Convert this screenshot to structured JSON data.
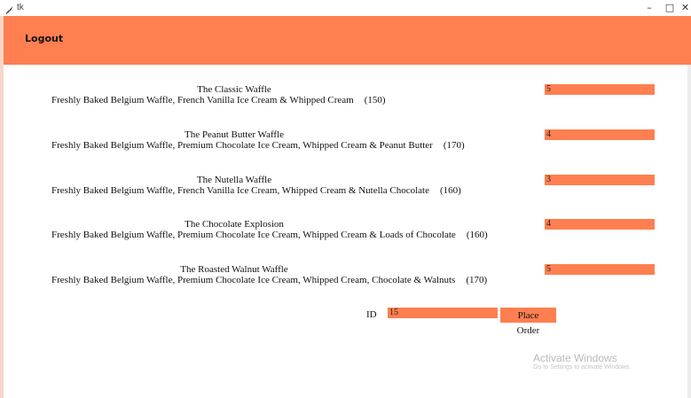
{
  "window": {
    "title": "tk",
    "controls": {
      "minimize": "–",
      "maximize": "□",
      "close": "✕"
    }
  },
  "header": {
    "logout_label": "Logout"
  },
  "menu": {
    "items": [
      {
        "name": "The Classic Waffle",
        "description": "Freshly Baked Belgium Waffle, French Vanilla Ice Cream & Whipped Cream",
        "price": "(150)",
        "quantity": "5"
      },
      {
        "name": "The Peanut Butter Waffle",
        "description": "Freshly Baked Belgium Waffle, Premium Chocolate Ice Cream, Whipped Cream & Peanut Butter",
        "price": "(170)",
        "quantity": "4"
      },
      {
        "name": "The Nutella Waffle",
        "description": "Freshly Baked Belgium Waffle, French Vanilla Ice Cream, Whipped Cream & Nutella Chocolate",
        "price": "(160)",
        "quantity": "3"
      },
      {
        "name": "The Chocolate Explosion",
        "description": "Freshly Baked Belgium Waffle, Premium Chocolate Ice Cream, Whipped Cream & Loads of Chocolate",
        "price": "(160)",
        "quantity": "4"
      },
      {
        "name": "The Roasted Walnut Waffle",
        "description": "Freshly Baked Belgium Waffle, Premium Chocolate Ice Cream, Whipped Cream, Chocolate & Walnuts",
        "price": "(170)",
        "quantity": "5"
      }
    ]
  },
  "order": {
    "id_label": "ID",
    "id_value": "15",
    "place_order_label": "Place Order"
  },
  "watermark": {
    "title": "Activate Windows",
    "subtitle": "Go to Settings to activate Windows."
  },
  "colors": {
    "accent": "#ff7f50",
    "background": "#ffffff"
  }
}
